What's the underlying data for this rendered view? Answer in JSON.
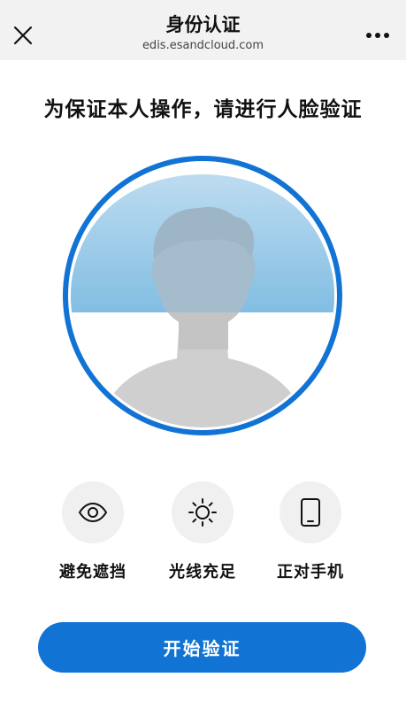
{
  "topbar": {
    "title": "身份认证",
    "domain": "edis.esandcloud.com",
    "close_icon": "close-icon",
    "more_icon": "more-dots-icon"
  },
  "headline": "为保证本人操作，请进行人脸验证",
  "face_frame": {
    "icon": "face-silhouette-icon",
    "ring_color": "#1173d4"
  },
  "tips": [
    {
      "icon": "eye-icon",
      "label": "避免遮挡"
    },
    {
      "icon": "sun-icon",
      "label": "光线充足"
    },
    {
      "icon": "phone-icon",
      "label": "正对手机"
    }
  ],
  "start_button": {
    "label": "开始验证",
    "color": "#1173d4"
  }
}
